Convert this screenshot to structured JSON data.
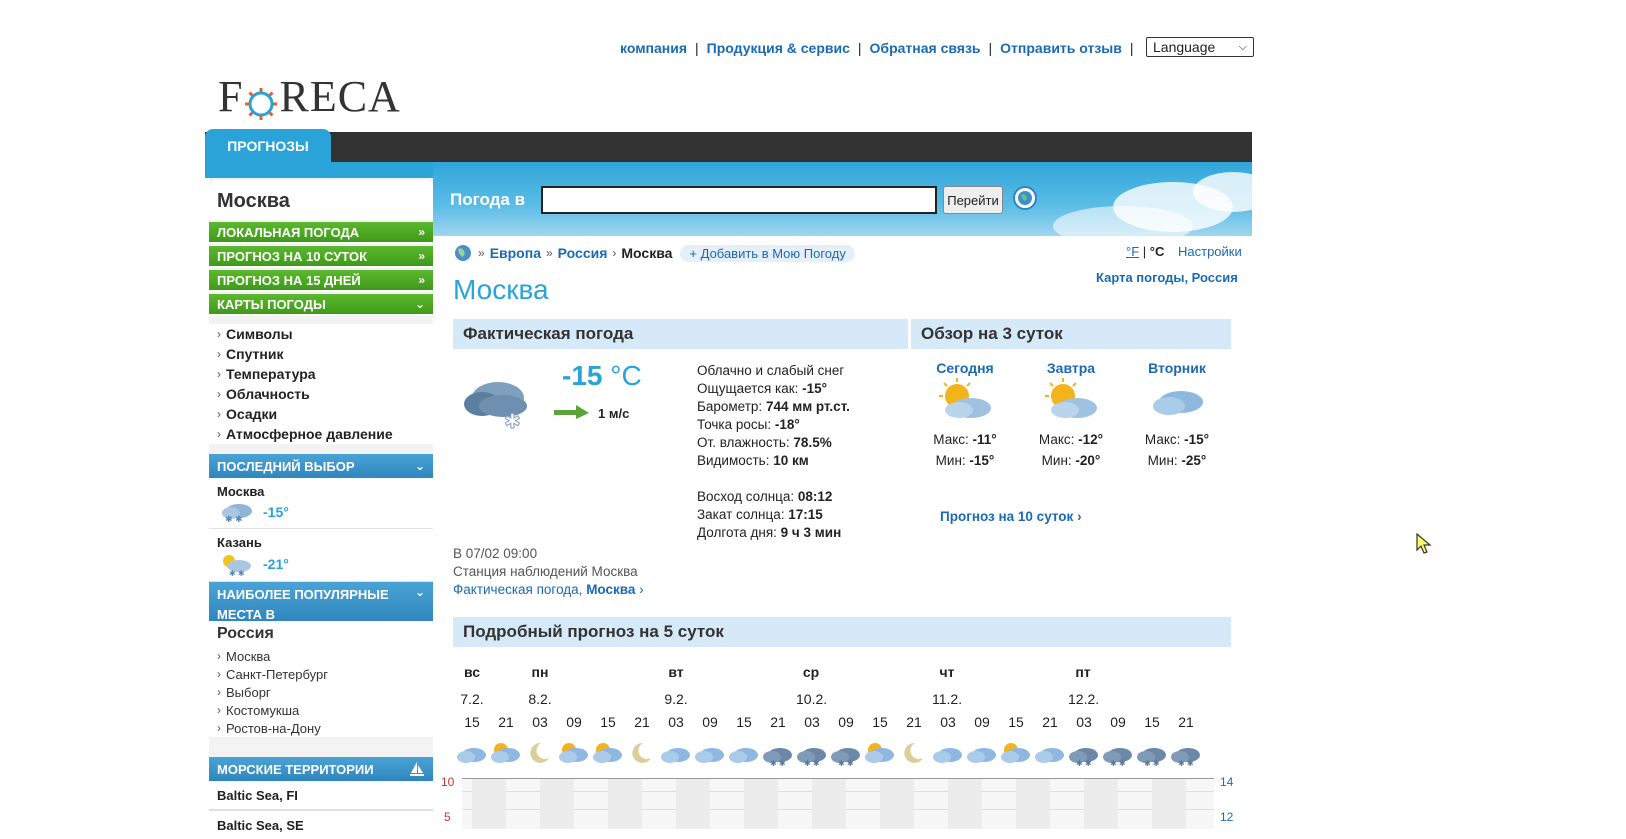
{
  "top_links": [
    "компания",
    "Продукция & сервис",
    "Обратная связь",
    "Отправить отзыв"
  ],
  "language": "Language",
  "logo": {
    "pre": "F",
    "post": "RECA"
  },
  "nav_tab": "ПРОГНОЗЫ",
  "sidebar": {
    "title": "Москва",
    "menu": [
      "ЛОКАЛЬНАЯ ПОГОДА",
      "ПРОГНОЗ НА 10 СУТОК",
      "ПРОГНОЗ НА 15 ДНЕЙ",
      "КАРТЫ ПОГОДЫ"
    ],
    "map_items": [
      "Символы",
      "Спутник",
      "Температура",
      "Облачность",
      "Осадки",
      "Атмосферное давление"
    ],
    "recent_header": "ПОСЛЕДНИЙ ВЫБОР",
    "recent": [
      {
        "name": "Москва",
        "temp": "-15°"
      },
      {
        "name": "Казань",
        "temp": "-21°"
      }
    ],
    "popular_header": "НАИБОЛЕЕ ПОПУЛЯРНЫЕ МЕСТА В",
    "popular_country": "Россия",
    "popular_items": [
      "Москва",
      "Санкт-Петербург",
      "Выборг",
      "Костомукша",
      "Ростов-на-Дону"
    ],
    "sea_header": "МОРСКИЕ ТЕРРИТОРИИ",
    "sea_items": [
      "Baltic Sea, FI",
      "Baltic Sea, SE"
    ]
  },
  "search": {
    "label": "Погода в",
    "value": "",
    "button": "Перейти"
  },
  "breadcrumb": {
    "europe": "Европа",
    "russia": "Россия",
    "current": "Москва",
    "add": "+ Добавить в Мою Погоду"
  },
  "units": {
    "f": "°F",
    "sep": "|",
    "c": "°C",
    "settings": "Настройки"
  },
  "weather_map": "Карта погоды, Россия",
  "city_title": "Москва",
  "current": {
    "header": "Фактическая погода",
    "temp": "-15",
    "temp_unit": "°C",
    "wind": "1 м/с",
    "condition": "Облачно и слабый снег",
    "feels_label": "Ощущается как:",
    "feels": "-15°",
    "pressure_label": "Барометр:",
    "pressure": "744 мм рт.ст.",
    "dew_label": "Точка росы:",
    "dew": "-18°",
    "humidity_label": "От. влажность:",
    "humidity": "78.5%",
    "visibility_label": "Видимость:",
    "visibility": "10 км",
    "sunrise_label": "Восход солнца:",
    "sunrise": "08:12",
    "sunset_label": "Закат солнца:",
    "sunset": "17:15",
    "daylen_label": "Долгота дня:",
    "daylen": "9 ч 3 мин",
    "obs_time": "В 07/02 09:00",
    "station": "Станция наблюдений Москва",
    "obs_link_pre": "Фактическая погода,",
    "obs_link_city": "Москва"
  },
  "overview": {
    "header": "Обзор на 3 суток",
    "max_label": "Макс:",
    "min_label": "Мин:",
    "days": [
      {
        "name": "Сегодня",
        "max": "-11°",
        "min": "-15°"
      },
      {
        "name": "Завтра",
        "max": "-12°",
        "min": "-20°"
      },
      {
        "name": "Вторник",
        "max": "-15°",
        "min": "-25°"
      }
    ],
    "link": "Прогноз на 10 суток"
  },
  "forecast5": {
    "header": "Подробный прогноз на 5 суток",
    "days": [
      {
        "name": "вс",
        "date": "7.2."
      },
      {
        "name": "пн",
        "date": "8.2."
      },
      {
        "name": "вт",
        "date": "9.2."
      },
      {
        "name": "ср",
        "date": "10.2."
      },
      {
        "name": "чт",
        "date": "11.2."
      },
      {
        "name": "пт",
        "date": "12.2."
      }
    ],
    "hours": [
      "15",
      "21",
      "03",
      "09",
      "15",
      "21",
      "03",
      "09",
      "15",
      "21",
      "03",
      "09",
      "15",
      "21",
      "03",
      "09",
      "15",
      "21",
      "03",
      "09",
      "15",
      "21"
    ],
    "axis_left": [
      "10",
      "5"
    ],
    "axis_right": [
      "14",
      "12"
    ]
  }
}
